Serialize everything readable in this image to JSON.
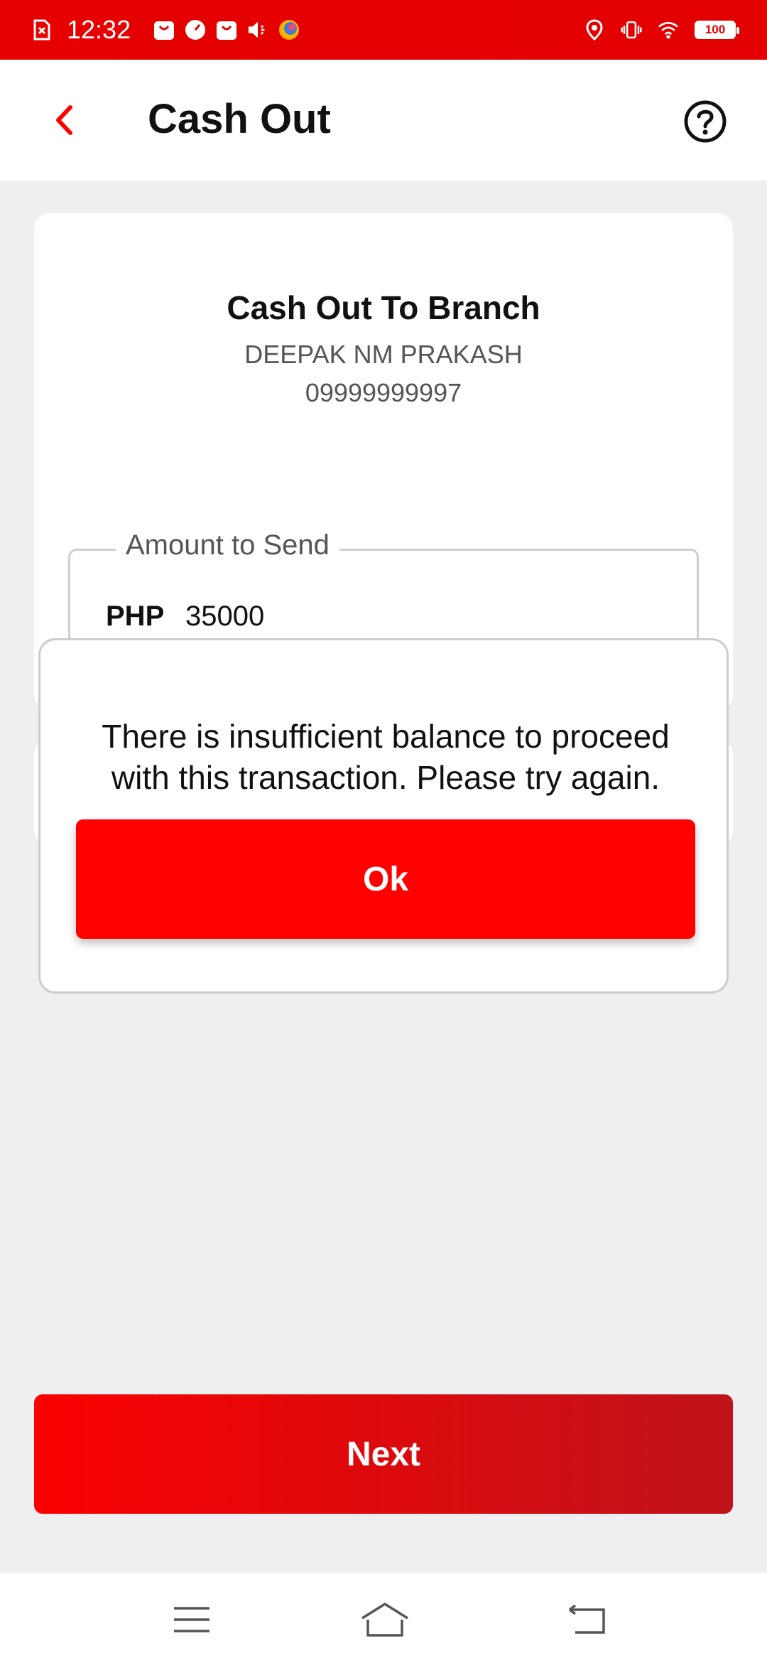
{
  "status_bar": {
    "time": "12:32",
    "battery": "100"
  },
  "header": {
    "title": "Cash Out"
  },
  "card": {
    "title": "Cash Out To Branch",
    "name": "DEEPAK NM PRAKASH",
    "phone": "09999999997"
  },
  "amount": {
    "label": "Amount to Send",
    "currency": "PHP",
    "value": "35000"
  },
  "modal": {
    "message": "There is insufficient balance to proceed with this transaction. Please try again.",
    "ok_label": "Ok"
  },
  "footer": {
    "next_label": "Next"
  },
  "colors": {
    "brand_red": "#ff0000",
    "status_bar": "#e60000",
    "background": "#eeeff1"
  }
}
